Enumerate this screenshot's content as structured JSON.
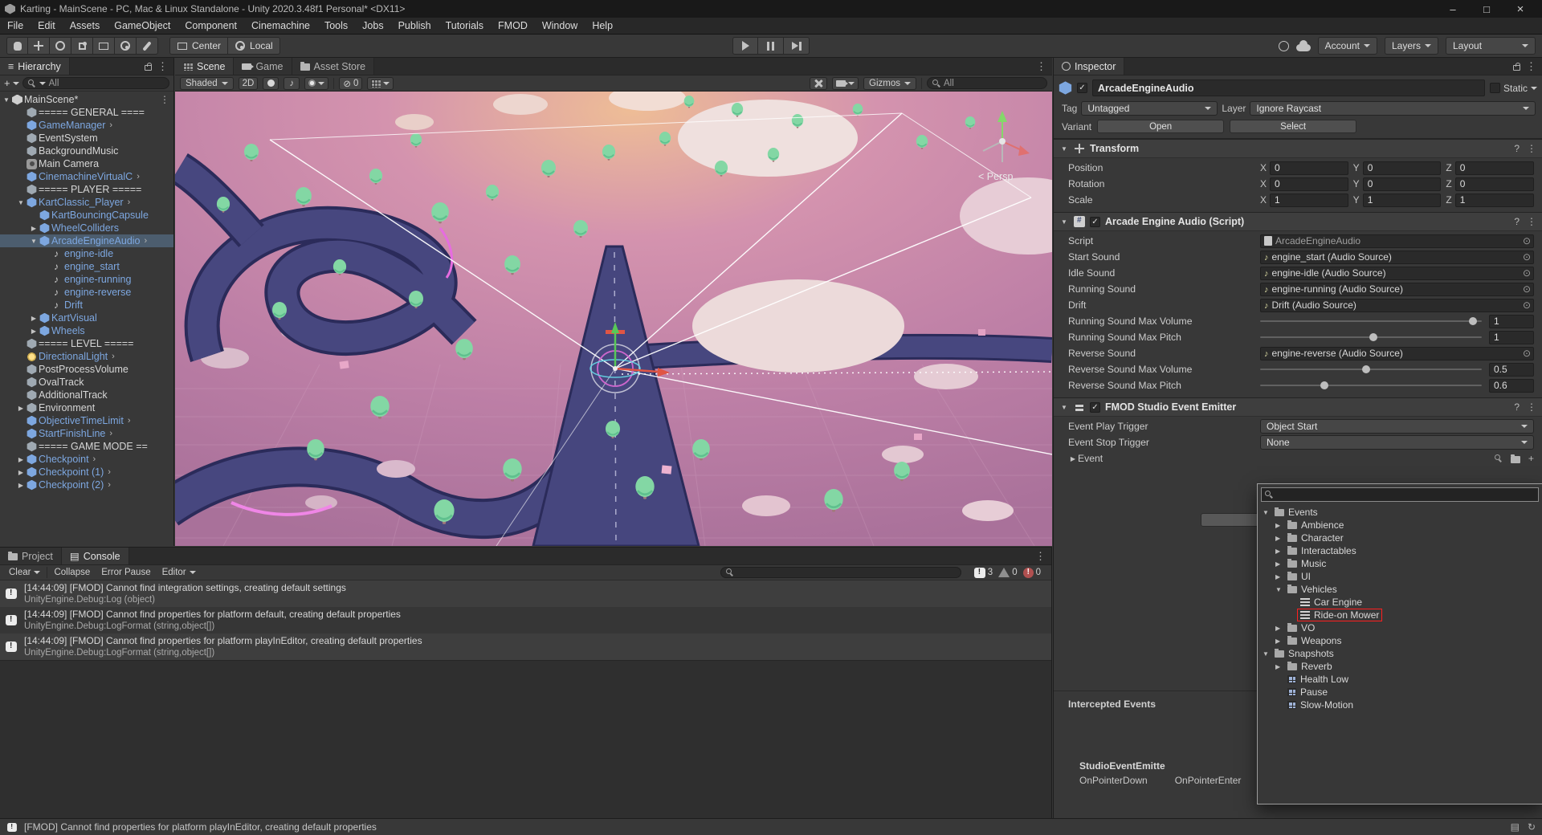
{
  "window": {
    "title": "Karting - MainScene - PC, Mac & Linux Standalone - Unity 2020.3.48f1 Personal* <DX11>",
    "menus": [
      "File",
      "Edit",
      "Assets",
      "GameObject",
      "Component",
      "Cinemachine",
      "Tools",
      "Jobs",
      "Publish",
      "Tutorials",
      "FMOD",
      "Window",
      "Help"
    ]
  },
  "toolbar": {
    "pivot": "Center",
    "space": "Local",
    "account": "Account",
    "layers": "Layers",
    "layout": "Layout"
  },
  "hierarchy": {
    "tab": "Hierarchy",
    "search": "All",
    "items": [
      {
        "label": "MainScene*",
        "cls": "d0 end",
        "exp": "▼",
        "icon": "ic ic-scene",
        "tail": "⋮"
      },
      {
        "label": "===== GENERAL ====",
        "cls": "d1",
        "exp": "",
        "icon": "ic ic-cube",
        "tail": ""
      },
      {
        "label": "GameManager",
        "cls": "d1 pf",
        "exp": "",
        "icon": "ic ic-cube-b",
        "tail": "›"
      },
      {
        "label": "EventSystem",
        "cls": "d1",
        "exp": "",
        "icon": "ic ic-cube",
        "tail": ""
      },
      {
        "label": "BackgroundMusic",
        "cls": "d1",
        "exp": "",
        "icon": "ic ic-cube",
        "tail": ""
      },
      {
        "label": "Main Camera",
        "cls": "d1",
        "exp": "",
        "icon": "ic ic-cam",
        "tail": ""
      },
      {
        "label": "CinemachineVirtualC",
        "cls": "d1 pf",
        "exp": "",
        "icon": "ic ic-cube-b",
        "tail": "›"
      },
      {
        "label": "===== PLAYER =====",
        "cls": "d1",
        "exp": "",
        "icon": "ic ic-cube",
        "tail": ""
      },
      {
        "label": "KartClassic_Player",
        "cls": "d1 pf",
        "exp": "▼",
        "icon": "ic ic-cube-b",
        "tail": "›"
      },
      {
        "label": "KartBouncingCapsule",
        "cls": "d2 pf",
        "exp": "",
        "icon": "ic ic-cube-b",
        "tail": ""
      },
      {
        "label": "WheelColliders",
        "cls": "d2 pf",
        "exp": "▶",
        "icon": "ic ic-cube-b",
        "tail": ""
      },
      {
        "label": "ArcadeEngineAudio",
        "cls": "d2 pf sel",
        "exp": "▼",
        "icon": "ic ic-cube-b",
        "tail": "›"
      },
      {
        "label": "engine-idle",
        "cls": "d3 pf",
        "exp": "",
        "icon": "ic ic-audio",
        "tail": ""
      },
      {
        "label": "engine_start",
        "cls": "d3 pf",
        "exp": "",
        "icon": "ic ic-audio",
        "tail": ""
      },
      {
        "label": "engine-running",
        "cls": "d3 pf",
        "exp": "",
        "icon": "ic ic-audio",
        "tail": ""
      },
      {
        "label": "engine-reverse",
        "cls": "d3 pf",
        "exp": "",
        "icon": "ic ic-audio",
        "tail": ""
      },
      {
        "label": "Drift",
        "cls": "d3 pf",
        "exp": "",
        "icon": "ic ic-audio",
        "tail": ""
      },
      {
        "label": "KartVisual",
        "cls": "d2 pf",
        "exp": "▶",
        "icon": "ic ic-cube-b",
        "tail": ""
      },
      {
        "label": "Wheels",
        "cls": "d2 pf",
        "exp": "▶",
        "icon": "ic ic-cube-b",
        "tail": ""
      },
      {
        "label": "===== LEVEL =====",
        "cls": "d1",
        "exp": "",
        "icon": "ic ic-cube",
        "tail": ""
      },
      {
        "label": "DirectionalLight",
        "cls": "d1 pf",
        "exp": "",
        "icon": "ic ic-light",
        "tail": "›"
      },
      {
        "label": "PostProcessVolume",
        "cls": "d1",
        "exp": "",
        "icon": "ic ic-cube",
        "tail": ""
      },
      {
        "label": "OvalTrack",
        "cls": "d1",
        "exp": "",
        "icon": "ic ic-cube",
        "tail": ""
      },
      {
        "label": "AdditionalTrack",
        "cls": "d1",
        "exp": "",
        "icon": "ic ic-cube",
        "tail": ""
      },
      {
        "label": "Environment",
        "cls": "d1",
        "exp": "▶",
        "icon": "ic ic-cube",
        "tail": ""
      },
      {
        "label": "ObjectiveTimeLimit",
        "cls": "d1 pf",
        "exp": "",
        "icon": "ic ic-cube-b",
        "tail": "›"
      },
      {
        "label": "StartFinishLine",
        "cls": "d1 pf",
        "exp": "",
        "icon": "ic ic-cube-b",
        "tail": "›"
      },
      {
        "label": "===== GAME MODE ==",
        "cls": "d1",
        "exp": "",
        "icon": "ic ic-cube",
        "tail": ""
      },
      {
        "label": "Checkpoint",
        "cls": "d1 pf",
        "exp": "▶",
        "icon": "ic ic-cube-b",
        "tail": "›"
      },
      {
        "label": "Checkpoint (1)",
        "cls": "d1 pf",
        "exp": "▶",
        "icon": "ic ic-cube-b",
        "tail": "›"
      },
      {
        "label": "Checkpoint (2)",
        "cls": "d1 pf",
        "exp": "▶",
        "icon": "ic ic-cube-b",
        "tail": "›"
      }
    ]
  },
  "scene": {
    "tabs": [
      "Scene",
      "Game",
      "Asset Store"
    ],
    "shading": "Shaded",
    "two_d": "2D",
    "hidden_count": "0",
    "gizmos": "Gizmos",
    "search": "All",
    "persp": "< Persp"
  },
  "inspector": {
    "tab": "Inspector",
    "name": "ArcadeEngineAudio",
    "static_label": "Static",
    "tag_label": "Tag",
    "tag": "Untagged",
    "layer_label": "Layer",
    "layer": "Ignore Raycast",
    "variant_label": "Variant",
    "open": "Open",
    "select": "Select",
    "transform": {
      "title": "Transform",
      "ax": "X",
      "ay": "Y",
      "az": "Z",
      "rows": [
        {
          "label": "Position",
          "x": "0",
          "y": "0",
          "z": "0"
        },
        {
          "label": "Rotation",
          "x": "0",
          "y": "0",
          "z": "0"
        },
        {
          "label": "Scale",
          "x": "1",
          "y": "1",
          "z": "1"
        }
      ]
    },
    "audio": {
      "title": "Arcade Engine Audio (Script)",
      "rows": [
        {
          "label": "Script",
          "value": "ArcadeEngineAudio",
          "cls": "t-script"
        },
        {
          "label": "Start Sound",
          "value": "engine_start (Audio Source)",
          "cls": "t-obj"
        },
        {
          "label": "Idle Sound",
          "value": "engine-idle (Audio Source)",
          "cls": "t-obj"
        },
        {
          "label": "Running Sound",
          "value": "engine-running (Audio Source)",
          "cls": "t-obj"
        },
        {
          "label": "Drift",
          "value": "Drift (Audio Source)",
          "cls": "t-obj"
        },
        {
          "label": "Running Sound Max Volume",
          "value": "1",
          "cls": "t-slider",
          "pos": "--p:96%"
        },
        {
          "label": "Running Sound Max Pitch",
          "value": "1",
          "cls": "t-slider",
          "pos": "--p:51%"
        },
        {
          "label": "Reverse Sound",
          "value": "engine-reverse (Audio Source)",
          "cls": "t-obj"
        },
        {
          "label": "Reverse Sound Max Volume",
          "value": "0.5",
          "cls": "t-slider",
          "pos": "--p:48%"
        },
        {
          "label": "Reverse Sound Max Pitch",
          "value": "0.6",
          "cls": "t-slider",
          "pos": "--p:29%"
        }
      ]
    },
    "fmod": {
      "title": "FMOD Studio Event Emitter",
      "play_label": "Event Play Trigger",
      "play": "Object Start",
      "stop_label": "Event Stop Trigger",
      "stop": "None",
      "event_label": "Event"
    },
    "intercepted": "Intercepted Events",
    "emitter": "StudioEventEmitte",
    "pointer_down": "OnPointerDown",
    "pointer_enter": "OnPointerEnter"
  },
  "event_browser": {
    "search": "",
    "items": [
      {
        "label": "Events",
        "cls": "d0",
        "exp": "▼",
        "icon": "fic-folder"
      },
      {
        "label": "Ambience",
        "cls": "d1",
        "exp": "▶",
        "icon": "fic-folder"
      },
      {
        "label": "Character",
        "cls": "d1",
        "exp": "▶",
        "icon": "fic-folder"
      },
      {
        "label": "Interactables",
        "cls": "d1",
        "exp": "▶",
        "icon": "fic-folder"
      },
      {
        "label": "Music",
        "cls": "d1",
        "exp": "▶",
        "icon": "fic-folder"
      },
      {
        "label": "UI",
        "cls": "d1",
        "exp": "▶",
        "icon": "fic-folder"
      },
      {
        "label": "Vehicles",
        "cls": "d1",
        "exp": "▼",
        "icon": "fic-folder"
      },
      {
        "label": "Car Engine",
        "cls": "d2",
        "exp": "",
        "icon": "fic-event"
      },
      {
        "label": "Ride-on Mower",
        "cls": "d2 hl",
        "exp": "",
        "icon": "fic-event"
      },
      {
        "label": "VO",
        "cls": "d1",
        "exp": "▶",
        "icon": "fic-folder"
      },
      {
        "label": "Weapons",
        "cls": "d1",
        "exp": "▶",
        "icon": "fic-folder"
      },
      {
        "label": "Snapshots",
        "cls": "d0",
        "exp": "▼",
        "icon": "fic-folder"
      },
      {
        "label": "Reverb",
        "cls": "d1",
        "exp": "▶",
        "icon": "fic-folder"
      },
      {
        "label": "Health Low",
        "cls": "d1",
        "exp": "",
        "icon": "fic-snap"
      },
      {
        "label": "Pause",
        "cls": "d1",
        "exp": "",
        "icon": "fic-snap"
      },
      {
        "label": "Slow-Motion",
        "cls": "d1",
        "exp": "",
        "icon": "fic-snap"
      }
    ]
  },
  "console": {
    "tab_project": "Project",
    "tab_console": "Console",
    "clear": "Clear",
    "collapse": "Collapse",
    "error_pause": "Error Pause",
    "editor": "Editor",
    "count_info": "3",
    "count_warn": "0",
    "count_error": "0",
    "messages": [
      {
        "line1": "[14:44:09] [FMOD] Cannot find integration settings, creating default settings",
        "line2": "UnityEngine.Debug:Log (object)"
      },
      {
        "line1": "[14:44:09] [FMOD] Cannot find properties for platform default, creating default properties",
        "line2": "UnityEngine.Debug:LogFormat (string,object[])"
      },
      {
        "line1": "[14:44:09] [FMOD] Cannot find properties for platform playInEditor, creating default properties",
        "line2": "UnityEngine.Debug:LogFormat (string,object[])"
      }
    ]
  },
  "status": {
    "message": "[FMOD] Cannot find properties for platform playInEditor, creating default properties"
  }
}
